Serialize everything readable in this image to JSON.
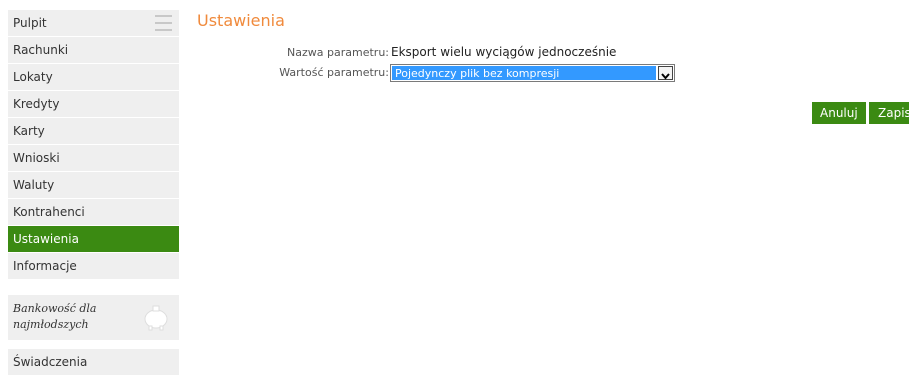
{
  "sidebar": {
    "items": [
      {
        "label": "Pulpit"
      },
      {
        "label": "Rachunki"
      },
      {
        "label": "Lokaty"
      },
      {
        "label": "Kredyty"
      },
      {
        "label": "Karty"
      },
      {
        "label": "Wnioski"
      },
      {
        "label": "Waluty"
      },
      {
        "label": "Kontrahenci"
      },
      {
        "label": "Ustawienia",
        "active": true
      },
      {
        "label": "Informacje"
      }
    ],
    "promo": {
      "line1": "Bankowość dla",
      "line2": "najmłodszych"
    },
    "last_item": "Świadczenia",
    "active_color": "#3b8a12"
  },
  "main": {
    "title": "Ustawienia",
    "param_name_label": "Nazwa parametru:",
    "param_name_value": "Eksport wielu wyciągów jednocześnie",
    "param_value_label": "Wartość parametru:",
    "param_value_selected": "Pojedynczy plik bez kompresji",
    "cancel_label": "Anuluj",
    "save_label": "Zapisz"
  },
  "colors": {
    "title": "#f08a3c",
    "button": "#3b8a12",
    "selection": "#3399ff"
  }
}
